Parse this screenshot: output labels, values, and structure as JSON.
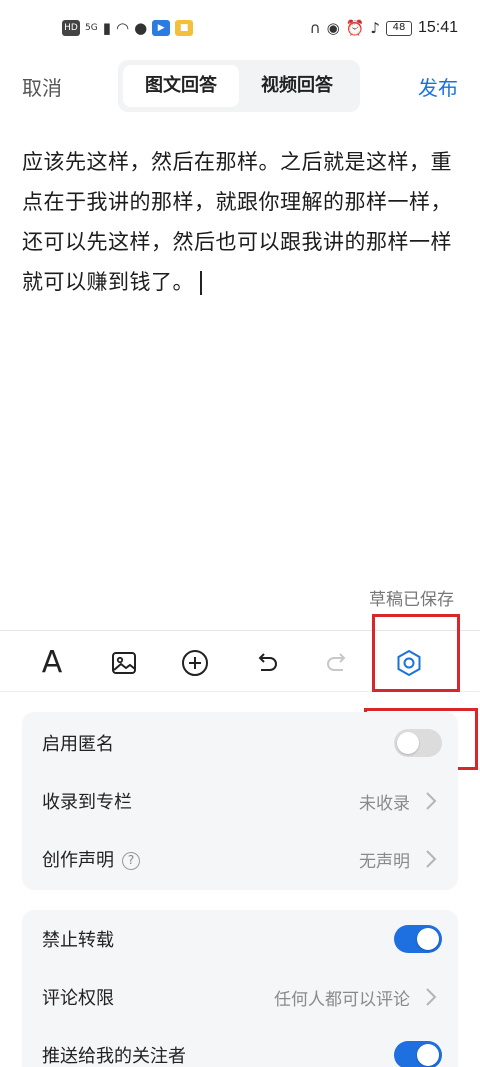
{
  "status_bar": {
    "hd": "HD",
    "network": "5G",
    "battery": "48",
    "time": "15:41"
  },
  "header": {
    "cancel_label": "取消",
    "tabs": [
      {
        "label": "图文回答",
        "active": true
      },
      {
        "label": "视频回答",
        "active": false
      }
    ],
    "publish_label": "发布"
  },
  "editor": {
    "content": "应该先这样，然后在那样。之后就是这样，重点在于我讲的那样，就跟你理解的那样一样，还可以先这样，然后也可以跟我讲的那样一样就可以赚到钱了。"
  },
  "draft_status": "草稿已保存",
  "toolbar": {
    "font_label": "A",
    "icons": [
      "font-icon",
      "image-icon",
      "add-icon",
      "undo-icon",
      "redo-icon",
      "settings-hex-icon"
    ]
  },
  "settings": {
    "group1": {
      "anonymous": {
        "label": "启用匿名",
        "enabled": false
      },
      "column": {
        "label": "收录到专栏",
        "value": "未收录"
      },
      "declaration": {
        "label": "创作声明",
        "help": "?",
        "value": "无声明"
      }
    },
    "group2": {
      "no_repost": {
        "label": "禁止转载",
        "enabled": true
      },
      "comment_permission": {
        "label": "评论权限",
        "value": "任何人都可以评论"
      },
      "push_followers": {
        "label": "推送给我的关注者",
        "enabled": true
      }
    }
  },
  "colors": {
    "accent": "#1a73d9",
    "toggle_on": "#1e6fe0",
    "highlight": "#d9262b"
  }
}
